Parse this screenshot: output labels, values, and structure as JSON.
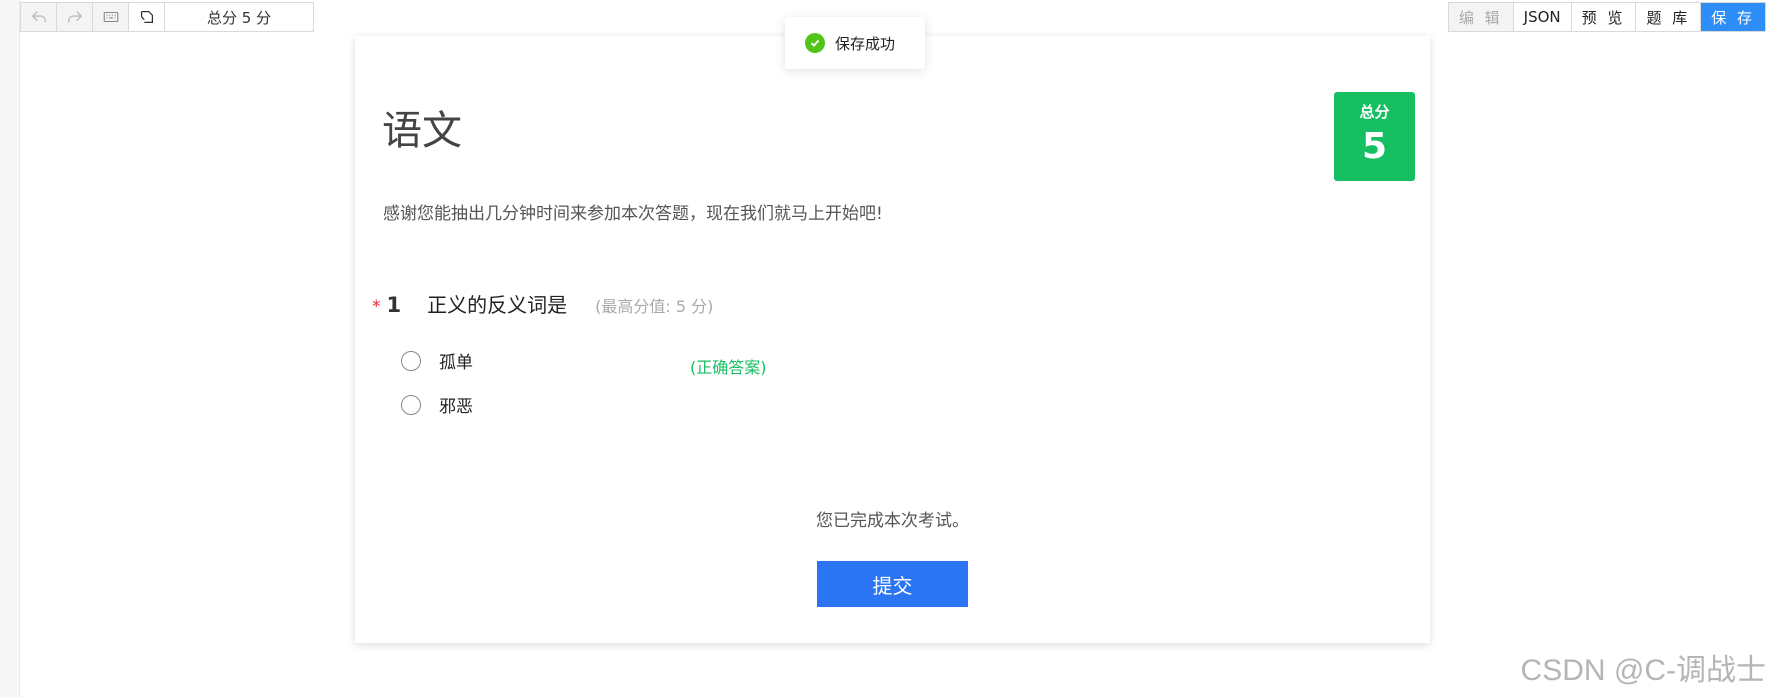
{
  "toolbar_left": {
    "buttons": [
      "undo-icon",
      "redo-icon",
      "keyboard-icon",
      "rotate-icon"
    ],
    "score_text": "总分 5 分"
  },
  "toolbar_right": {
    "edit": "编 辑",
    "json": "JSON",
    "preview": "预 览",
    "bank": "题 库",
    "save": "保 存"
  },
  "toast": {
    "message": "保存成功",
    "color": "#52c41a"
  },
  "survey": {
    "title": "语文",
    "badge_label": "总分",
    "badge_value": "5",
    "intro": "感谢您能抽出几分钟时间来参加本次答题，现在我们就马上开始吧!",
    "question": {
      "required_mark": "*",
      "number": "1",
      "text": "正义的反义词是",
      "max_score": "(最高分值: 5 分)",
      "options": [
        {
          "label": "孤单"
        },
        {
          "label": "邪恶"
        }
      ],
      "correct_note": "(正确答案)"
    },
    "completion": "您已完成本次考试。",
    "submit_label": "提交"
  },
  "watermark": "CSDN @C-调战士",
  "colors": {
    "accent": "#2e8ef7",
    "badge": "#17bf63",
    "submit": "#2b75f5"
  }
}
